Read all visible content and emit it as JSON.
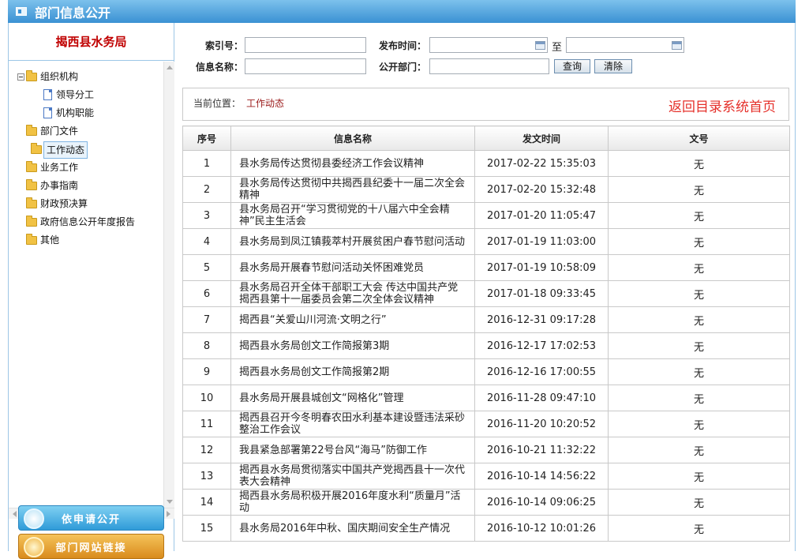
{
  "window": {
    "title": "部门信息公开"
  },
  "sidebar": {
    "org_name": "揭西县水务局",
    "tree": [
      {
        "label": "组织机构",
        "type": "folder",
        "level": 0,
        "expandable": true
      },
      {
        "label": "领导分工",
        "type": "doc",
        "level": 1
      },
      {
        "label": "机构职能",
        "type": "doc",
        "level": 1
      },
      {
        "label": "部门文件",
        "type": "folder",
        "level": 0
      },
      {
        "label": "工作动态",
        "type": "folder",
        "level": 0,
        "selected": true
      },
      {
        "label": "业务工作",
        "type": "folder",
        "level": 0
      },
      {
        "label": "办事指南",
        "type": "folder",
        "level": 0
      },
      {
        "label": "财政预决算",
        "type": "folder",
        "level": 0
      },
      {
        "label": "政府信息公开年度报告",
        "type": "folder",
        "level": 0
      },
      {
        "label": "其他",
        "type": "folder",
        "level": 0
      }
    ],
    "buttons": {
      "apply": "依申请公开",
      "links": "部门网站链接"
    }
  },
  "search": {
    "index_label": "索引号：",
    "publish_time_label": "发布时间：",
    "to_label": "至",
    "name_label": "信息名称：",
    "dept_label": "公开部门：",
    "query_button": "查询",
    "clear_button": "清除"
  },
  "breadcrumb": {
    "label": "当前位置：",
    "current": "工作动态",
    "home_link": "返回目录系统首页"
  },
  "table": {
    "headers": [
      "序号",
      "信息名称",
      "发文时间",
      "文号"
    ],
    "rows": [
      {
        "no": "1",
        "name": "县水务局传达贯彻县委经济工作会议精神",
        "date": "2017-02-22 15:35:03",
        "doc_no": "无"
      },
      {
        "no": "2",
        "name": "县水务局传达贯彻中共揭西县纪委十一届二次全会精神",
        "date": "2017-02-20 15:32:48",
        "doc_no": "无"
      },
      {
        "no": "3",
        "name": "县水务局召开“学习贯彻党的十八届六中全会精神”民主生活会",
        "date": "2017-01-20 11:05:47",
        "doc_no": "无"
      },
      {
        "no": "4",
        "name": "县水务局到凤江镇莪萃村开展贫困户春节慰问活动",
        "date": "2017-01-19 11:03:00",
        "doc_no": "无"
      },
      {
        "no": "5",
        "name": "县水务局开展春节慰问活动关怀困难党员",
        "date": "2017-01-19 10:58:09",
        "doc_no": "无"
      },
      {
        "no": "6",
        "name": "县水务局召开全体干部职工大会 传达中国共产党揭西县第十一届委员会第二次全体会议精神",
        "date": "2017-01-18 09:33:45",
        "doc_no": "无"
      },
      {
        "no": "7",
        "name": "揭西县“关爱山川河流·文明之行”",
        "date": "2016-12-31 09:17:28",
        "doc_no": "无"
      },
      {
        "no": "8",
        "name": "揭西县水务局创文工作简报第3期",
        "date": "2016-12-17 17:02:53",
        "doc_no": "无"
      },
      {
        "no": "9",
        "name": "揭西县水务局创文工作简报第2期",
        "date": "2016-12-16 17:00:55",
        "doc_no": "无"
      },
      {
        "no": "10",
        "name": "县水务局开展县城创文“网格化”管理",
        "date": "2016-11-28 09:47:10",
        "doc_no": "无"
      },
      {
        "no": "11",
        "name": "揭西县召开今冬明春农田水利基本建设暨违法采砂整治工作会议",
        "date": "2016-11-20 10:20:52",
        "doc_no": "无"
      },
      {
        "no": "12",
        "name": "我县紧急部署第22号台风“海马”防御工作",
        "date": "2016-10-21 11:32:22",
        "doc_no": "无"
      },
      {
        "no": "13",
        "name": "揭西县水务局贯彻落实中国共产党揭西县十一次代表大会精神",
        "date": "2016-10-14 14:56:22",
        "doc_no": "无"
      },
      {
        "no": "14",
        "name": "揭西县水务局积极开展2016年度水利“质量月”活动",
        "date": "2016-10-14 09:06:25",
        "doc_no": "无"
      },
      {
        "no": "15",
        "name": "县水务局2016年中秋、国庆期间安全生产情况",
        "date": "2016-10-12 10:01:26",
        "doc_no": "无"
      }
    ]
  }
}
